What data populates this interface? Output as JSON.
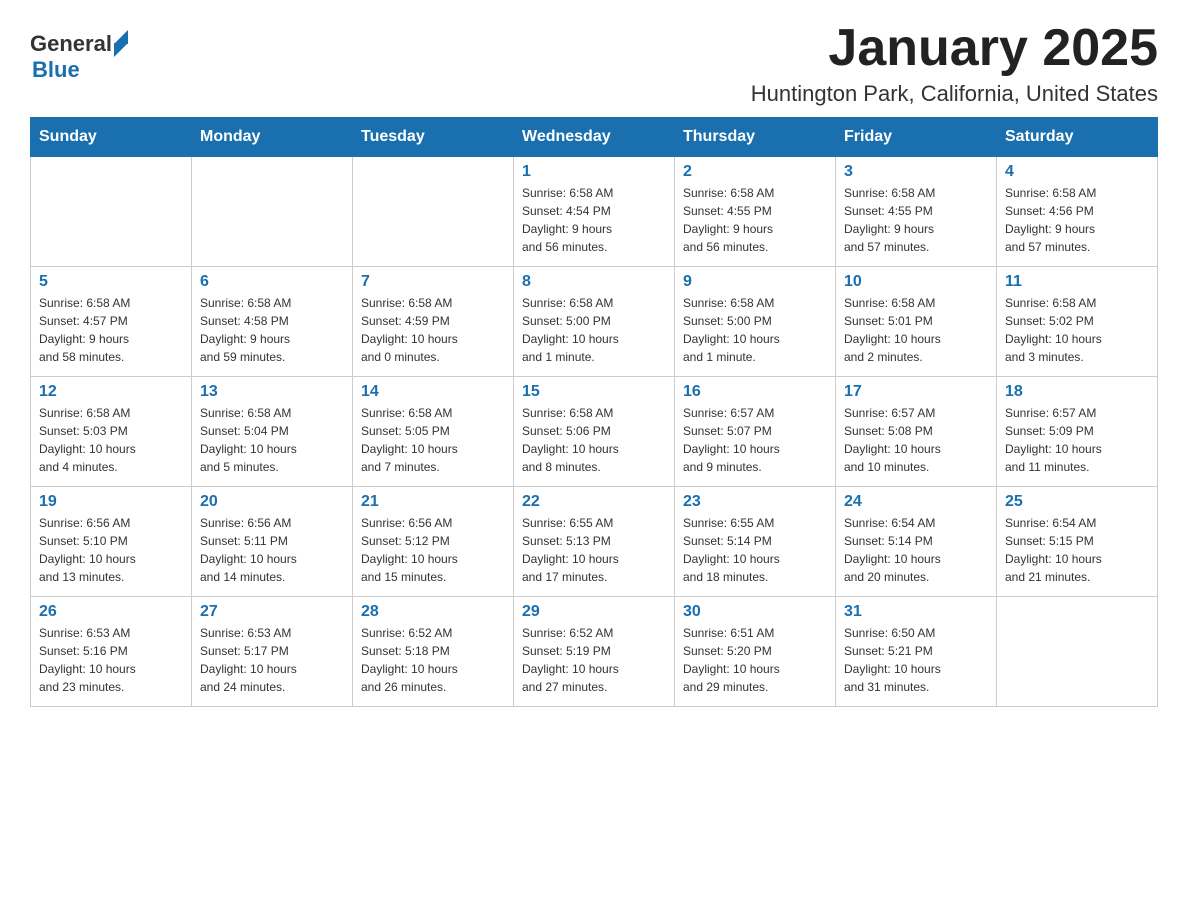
{
  "header": {
    "logo_general": "General",
    "logo_blue": "Blue",
    "title": "January 2025",
    "subtitle": "Huntington Park, California, United States"
  },
  "days_of_week": [
    "Sunday",
    "Monday",
    "Tuesday",
    "Wednesday",
    "Thursday",
    "Friday",
    "Saturday"
  ],
  "weeks": [
    [
      {
        "day": "",
        "info": ""
      },
      {
        "day": "",
        "info": ""
      },
      {
        "day": "",
        "info": ""
      },
      {
        "day": "1",
        "info": "Sunrise: 6:58 AM\nSunset: 4:54 PM\nDaylight: 9 hours\nand 56 minutes."
      },
      {
        "day": "2",
        "info": "Sunrise: 6:58 AM\nSunset: 4:55 PM\nDaylight: 9 hours\nand 56 minutes."
      },
      {
        "day": "3",
        "info": "Sunrise: 6:58 AM\nSunset: 4:55 PM\nDaylight: 9 hours\nand 57 minutes."
      },
      {
        "day": "4",
        "info": "Sunrise: 6:58 AM\nSunset: 4:56 PM\nDaylight: 9 hours\nand 57 minutes."
      }
    ],
    [
      {
        "day": "5",
        "info": "Sunrise: 6:58 AM\nSunset: 4:57 PM\nDaylight: 9 hours\nand 58 minutes."
      },
      {
        "day": "6",
        "info": "Sunrise: 6:58 AM\nSunset: 4:58 PM\nDaylight: 9 hours\nand 59 minutes."
      },
      {
        "day": "7",
        "info": "Sunrise: 6:58 AM\nSunset: 4:59 PM\nDaylight: 10 hours\nand 0 minutes."
      },
      {
        "day": "8",
        "info": "Sunrise: 6:58 AM\nSunset: 5:00 PM\nDaylight: 10 hours\nand 1 minute."
      },
      {
        "day": "9",
        "info": "Sunrise: 6:58 AM\nSunset: 5:00 PM\nDaylight: 10 hours\nand 1 minute."
      },
      {
        "day": "10",
        "info": "Sunrise: 6:58 AM\nSunset: 5:01 PM\nDaylight: 10 hours\nand 2 minutes."
      },
      {
        "day": "11",
        "info": "Sunrise: 6:58 AM\nSunset: 5:02 PM\nDaylight: 10 hours\nand 3 minutes."
      }
    ],
    [
      {
        "day": "12",
        "info": "Sunrise: 6:58 AM\nSunset: 5:03 PM\nDaylight: 10 hours\nand 4 minutes."
      },
      {
        "day": "13",
        "info": "Sunrise: 6:58 AM\nSunset: 5:04 PM\nDaylight: 10 hours\nand 5 minutes."
      },
      {
        "day": "14",
        "info": "Sunrise: 6:58 AM\nSunset: 5:05 PM\nDaylight: 10 hours\nand 7 minutes."
      },
      {
        "day": "15",
        "info": "Sunrise: 6:58 AM\nSunset: 5:06 PM\nDaylight: 10 hours\nand 8 minutes."
      },
      {
        "day": "16",
        "info": "Sunrise: 6:57 AM\nSunset: 5:07 PM\nDaylight: 10 hours\nand 9 minutes."
      },
      {
        "day": "17",
        "info": "Sunrise: 6:57 AM\nSunset: 5:08 PM\nDaylight: 10 hours\nand 10 minutes."
      },
      {
        "day": "18",
        "info": "Sunrise: 6:57 AM\nSunset: 5:09 PM\nDaylight: 10 hours\nand 11 minutes."
      }
    ],
    [
      {
        "day": "19",
        "info": "Sunrise: 6:56 AM\nSunset: 5:10 PM\nDaylight: 10 hours\nand 13 minutes."
      },
      {
        "day": "20",
        "info": "Sunrise: 6:56 AM\nSunset: 5:11 PM\nDaylight: 10 hours\nand 14 minutes."
      },
      {
        "day": "21",
        "info": "Sunrise: 6:56 AM\nSunset: 5:12 PM\nDaylight: 10 hours\nand 15 minutes."
      },
      {
        "day": "22",
        "info": "Sunrise: 6:55 AM\nSunset: 5:13 PM\nDaylight: 10 hours\nand 17 minutes."
      },
      {
        "day": "23",
        "info": "Sunrise: 6:55 AM\nSunset: 5:14 PM\nDaylight: 10 hours\nand 18 minutes."
      },
      {
        "day": "24",
        "info": "Sunrise: 6:54 AM\nSunset: 5:14 PM\nDaylight: 10 hours\nand 20 minutes."
      },
      {
        "day": "25",
        "info": "Sunrise: 6:54 AM\nSunset: 5:15 PM\nDaylight: 10 hours\nand 21 minutes."
      }
    ],
    [
      {
        "day": "26",
        "info": "Sunrise: 6:53 AM\nSunset: 5:16 PM\nDaylight: 10 hours\nand 23 minutes."
      },
      {
        "day": "27",
        "info": "Sunrise: 6:53 AM\nSunset: 5:17 PM\nDaylight: 10 hours\nand 24 minutes."
      },
      {
        "day": "28",
        "info": "Sunrise: 6:52 AM\nSunset: 5:18 PM\nDaylight: 10 hours\nand 26 minutes."
      },
      {
        "day": "29",
        "info": "Sunrise: 6:52 AM\nSunset: 5:19 PM\nDaylight: 10 hours\nand 27 minutes."
      },
      {
        "day": "30",
        "info": "Sunrise: 6:51 AM\nSunset: 5:20 PM\nDaylight: 10 hours\nand 29 minutes."
      },
      {
        "day": "31",
        "info": "Sunrise: 6:50 AM\nSunset: 5:21 PM\nDaylight: 10 hours\nand 31 minutes."
      },
      {
        "day": "",
        "info": ""
      }
    ]
  ]
}
